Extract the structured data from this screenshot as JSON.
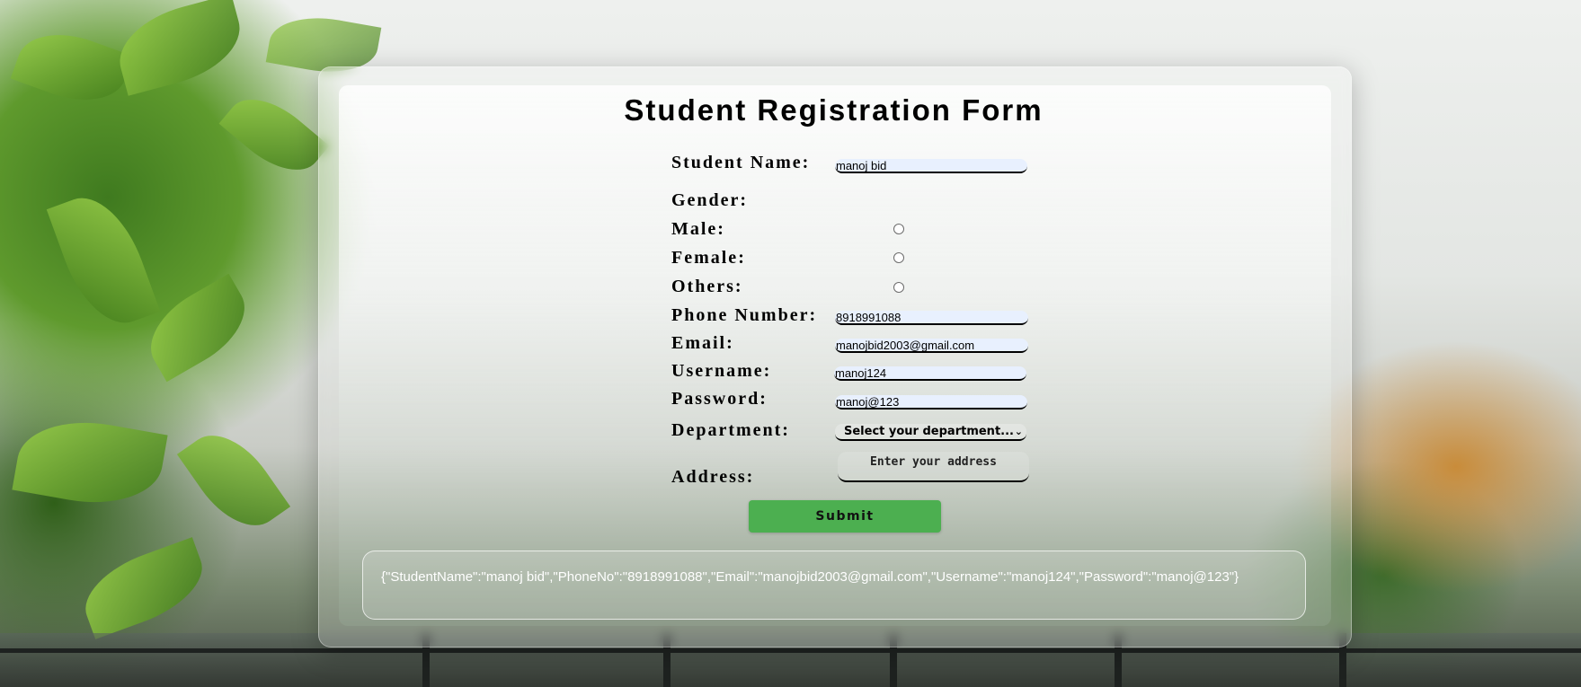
{
  "form": {
    "title": "Student Registration Form",
    "labels": {
      "student_name": "Student Name:",
      "gender": "Gender:",
      "male": "Male:",
      "female": "Female:",
      "others": "Others:",
      "phone": "Phone Number:",
      "email": "Email:",
      "username": "Username:",
      "password": "Password:",
      "department": "Department:",
      "address": "Address:"
    },
    "values": {
      "student_name": "manoj bid",
      "phone": "8918991088",
      "email": "manojbid2003@gmail.com",
      "username": "manoj124",
      "password": "manoj@123"
    },
    "department": {
      "selected": "Select your department...",
      "chevron_icon": "chevron-down-icon"
    },
    "address": {
      "placeholder": "Enter your address"
    },
    "gender": {
      "male_checked": false,
      "female_checked": false,
      "others_checked": false
    },
    "submit_label": "Submit"
  },
  "output": {
    "text": "{\"StudentName\":\"manoj bid\",\"PhoneNo\":\"8918991088\",\"Email\":\"manojbid2003@gmail.com\",\"Username\":\"manoj124\",\"Password\":\"manoj@123\"}"
  },
  "colors": {
    "submit_bg": "#4caf50",
    "input_bg": "#e8f0fe",
    "text": "#000000",
    "output_text": "#ffffff"
  }
}
